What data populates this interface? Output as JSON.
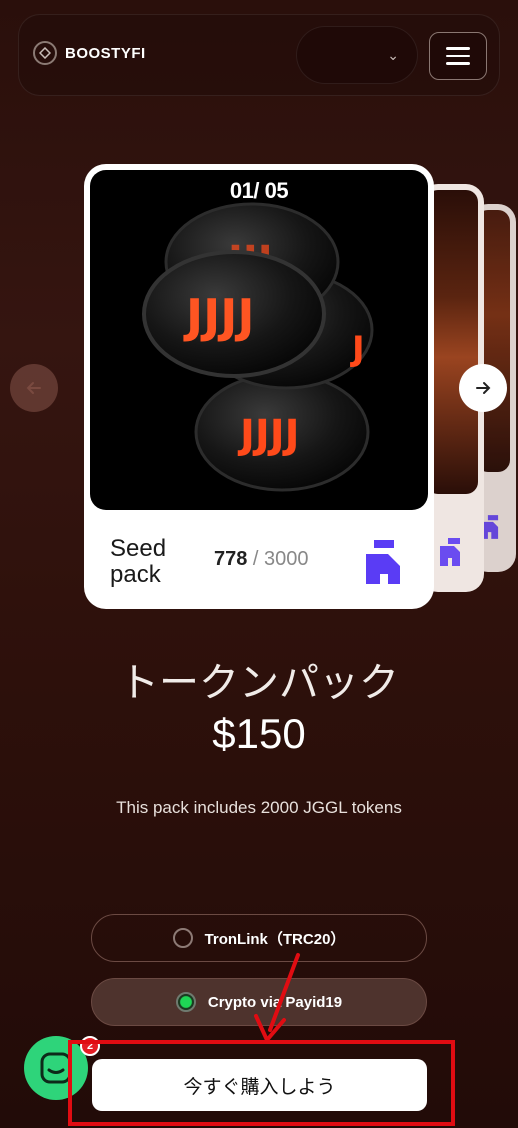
{
  "header": {
    "logo_text": "BOOSTYFI",
    "language_selector": {
      "selected": "",
      "icon": "chevron-down-icon"
    },
    "menu_icon": "hamburger-menu-icon"
  },
  "carousel": {
    "counter": "01/ 05",
    "card": {
      "name": "Seed pack",
      "name_line1": "Seed",
      "name_line2": "pack",
      "sold": "778",
      "separator": " / ",
      "total": "3000"
    },
    "prev_icon": "arrow-left-icon",
    "next_icon": "arrow-right-icon"
  },
  "product": {
    "title": "トークンパック",
    "price": "$150",
    "description": "This pack includes 2000 JGGL tokens"
  },
  "payment_options": [
    {
      "label": "TronLink（TRC20）",
      "selected": false
    },
    {
      "label": "Crypto via Payid19",
      "selected": true
    }
  ],
  "buy_button": {
    "label": "今すぐ購入しよう"
  },
  "chat": {
    "badge_count": "2"
  },
  "colors": {
    "background": "#2d100b",
    "accent_red": "#e00c12",
    "selected_radio": "#1fd655",
    "chat_green": "#2ed47a",
    "card_logo_purple": "#5a3cf5"
  }
}
